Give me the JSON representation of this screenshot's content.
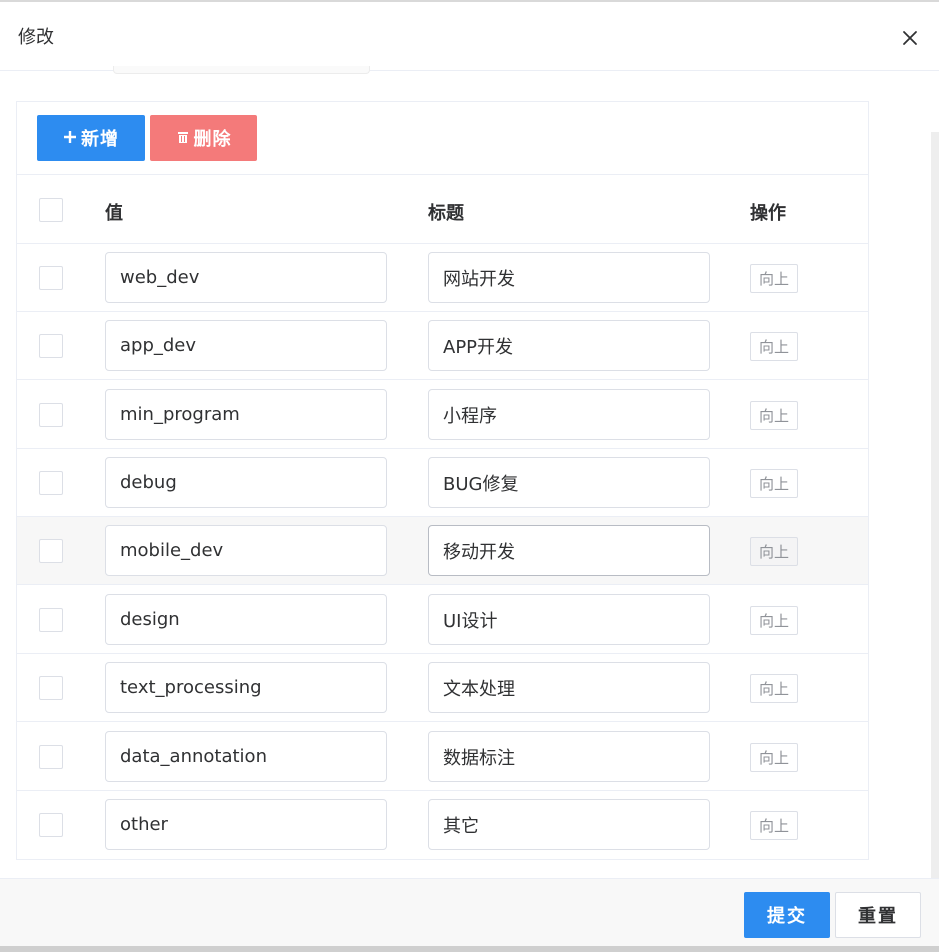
{
  "dialog": {
    "title": "修改"
  },
  "toolbar": {
    "add_label": "新增",
    "delete_label": "删除"
  },
  "table": {
    "headers": {
      "value": "值",
      "title": "标题",
      "action": "操作"
    },
    "up_label": "向上",
    "rows": [
      {
        "value": "web_dev",
        "title": "网站开发"
      },
      {
        "value": "app_dev",
        "title": "APP开发"
      },
      {
        "value": "min_program",
        "title": "小程序"
      },
      {
        "value": "debug",
        "title": "BUG修复"
      },
      {
        "value": "mobile_dev",
        "title": "移动开发"
      },
      {
        "value": "design",
        "title": "UI设计"
      },
      {
        "value": "text_processing",
        "title": "文本处理"
      },
      {
        "value": "data_annotation",
        "title": "数据标注"
      },
      {
        "value": "other",
        "title": "其它"
      }
    ]
  },
  "footer": {
    "submit_label": "提交",
    "reset_label": "重置"
  },
  "colors": {
    "primary": "#2d8cf0",
    "danger": "#f47a7a"
  }
}
